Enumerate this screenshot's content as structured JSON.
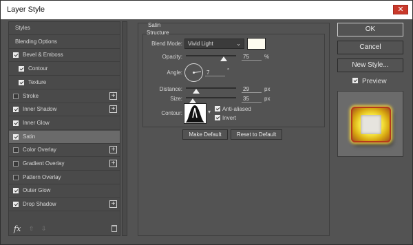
{
  "window": {
    "title": "Layer Style",
    "close": "✕"
  },
  "styles_list": [
    {
      "label": "Styles",
      "checkbox": null,
      "plus": false,
      "indent": false,
      "selected": false
    },
    {
      "label": "Blending Options",
      "checkbox": null,
      "plus": false,
      "indent": false,
      "selected": false
    },
    {
      "label": "Bevel & Emboss",
      "checkbox": true,
      "plus": false,
      "indent": false,
      "selected": false
    },
    {
      "label": "Contour",
      "checkbox": true,
      "plus": false,
      "indent": true,
      "selected": false
    },
    {
      "label": "Texture",
      "checkbox": true,
      "plus": false,
      "indent": true,
      "selected": false
    },
    {
      "label": "Stroke",
      "checkbox": false,
      "plus": true,
      "indent": false,
      "selected": false
    },
    {
      "label": "Inner Shadow",
      "checkbox": true,
      "plus": true,
      "indent": false,
      "selected": false
    },
    {
      "label": "Inner Glow",
      "checkbox": true,
      "plus": false,
      "indent": false,
      "selected": false
    },
    {
      "label": "Satin",
      "checkbox": true,
      "plus": false,
      "indent": false,
      "selected": true
    },
    {
      "label": "Color Overlay",
      "checkbox": false,
      "plus": true,
      "indent": false,
      "selected": false
    },
    {
      "label": "Gradient Overlay",
      "checkbox": false,
      "plus": true,
      "indent": false,
      "selected": false
    },
    {
      "label": "Pattern Overlay",
      "checkbox": false,
      "plus": false,
      "indent": false,
      "selected": false
    },
    {
      "label": "Outer Glow",
      "checkbox": true,
      "plus": false,
      "indent": false,
      "selected": false
    },
    {
      "label": "Drop Shadow",
      "checkbox": true,
      "plus": true,
      "indent": false,
      "selected": false
    }
  ],
  "bottom": {
    "fx": "fx",
    "up": "⇧",
    "down": "⇩"
  },
  "satin": {
    "section": "Satin",
    "structure": "Structure",
    "blend_mode_label": "Blend Mode:",
    "blend_mode_value": "Vivid Light",
    "blend_color": "#fdfbef",
    "opacity_label": "Opacity:",
    "opacity_value": "75",
    "opacity_unit": "%",
    "opacity_fraction": 0.75,
    "angle_label": "Angle:",
    "angle_value": "7",
    "angle_unit": "°",
    "distance_label": "Distance:",
    "distance_value": "29",
    "distance_unit": "px",
    "distance_fraction": 0.2,
    "size_label": "Size:",
    "size_value": "35",
    "size_unit": "px",
    "size_fraction": 0.14,
    "contour_label": "Contour:",
    "anti_aliased_label": "Anti-aliased",
    "anti_aliased": true,
    "invert_label": "Invert",
    "invert": true,
    "make_default": "Make Default",
    "reset_default": "Reset to Default"
  },
  "actions": {
    "ok": "OK",
    "cancel": "Cancel",
    "new_style": "New Style...",
    "preview_label": "Preview",
    "preview_checked": true
  }
}
